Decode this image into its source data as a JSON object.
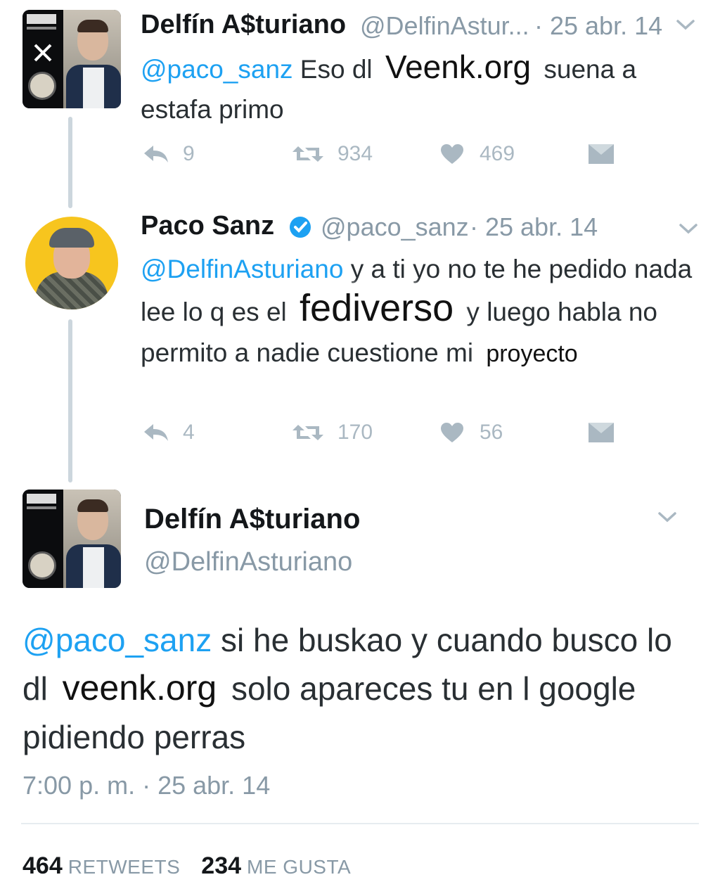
{
  "tweets": [
    {
      "display_name": "Delfín A$turiano",
      "handle": "@DelfinAstur...",
      "date": "· 25 abr. 14",
      "text": {
        "mention": "@paco_sanz",
        "part1": " Eso dl ",
        "overlay": "Veenk.org",
        "part2": " suena a estafa primo"
      },
      "actions": {
        "replies": "9",
        "retweets": "934",
        "likes": "469"
      },
      "icons": [
        "reply-icon",
        "retweet-icon",
        "like-icon",
        "dm-icon",
        "chevron-down-icon"
      ]
    },
    {
      "display_name": "Paco Sanz",
      "verified": true,
      "handle": "@paco_sanz",
      "date": "· 25 abr. 14",
      "text": {
        "mention": "@DelfinAsturiano",
        "part1": " y a ti yo no te he pedido nada lee lo q es el ",
        "overlay": "fediverso",
        "part2": " y luego habla no permito a nadie cuestione mi ",
        "overlay2": "proyecto"
      },
      "actions": {
        "replies": "4",
        "retweets": "170",
        "likes": "56"
      }
    }
  ],
  "main_tweet": {
    "display_name": "Delfín A$turiano",
    "handle": "@DelfinAsturiano",
    "text": {
      "mention": "@paco_sanz",
      "part1": " si he buskao y cuando busco lo dl ",
      "overlay": "veenk.org",
      "part2": " solo apareces tu en l google pidiendo perras"
    },
    "timestamp": "7:00 p. m. · 25 abr. 14",
    "stats": {
      "retweets_count": "464",
      "retweets_label": "RETWEETS",
      "likes_count": "234",
      "likes_label": "ME GUSTA"
    }
  },
  "colors": {
    "link": "#1da1f2",
    "muted": "#8899a6",
    "verified": "#1da1f2",
    "icon": "#aab8c2"
  }
}
